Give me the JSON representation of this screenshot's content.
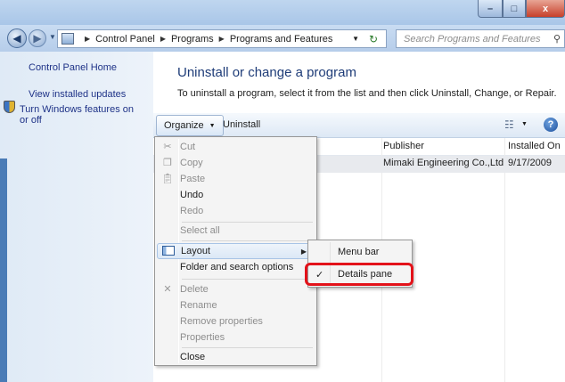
{
  "window": {
    "controls": {
      "minimize": "–",
      "maximize": "□",
      "close": "x"
    }
  },
  "address_bar": {
    "back_icon": "back-arrow-icon",
    "breadcrumbs": [
      "Control Panel",
      "Programs",
      "Programs and Features"
    ],
    "search_placeholder": "Search Programs and Features"
  },
  "left_pane": {
    "links": [
      "Control Panel Home",
      "View installed updates",
      "Turn Windows features on or off"
    ]
  },
  "main": {
    "title": "Uninstall or change a program",
    "description": "To uninstall a program, select it from the list and then click Uninstall, Change, or Repair.",
    "toolbar": {
      "organize": "Organize",
      "uninstall": "Uninstall"
    },
    "columns": {
      "publisher": "Publisher",
      "installed_on": "Installed On"
    },
    "rows": [
      {
        "publisher": "Mimaki Engineering Co.,Ltd",
        "installed_on": "9/17/2009"
      }
    ]
  },
  "organize_menu": {
    "items": [
      "Cut",
      "Copy",
      "Paste",
      "Undo",
      "Redo",
      "Select all",
      "Layout",
      "Folder and search options",
      "Delete",
      "Rename",
      "Remove properties",
      "Properties",
      "Close"
    ]
  },
  "layout_submenu": {
    "items": [
      "Menu bar",
      "Details pane"
    ],
    "checked": "Details pane"
  },
  "colors": {
    "annotation_outline": "#e3121a",
    "link": "#1e3287"
  }
}
